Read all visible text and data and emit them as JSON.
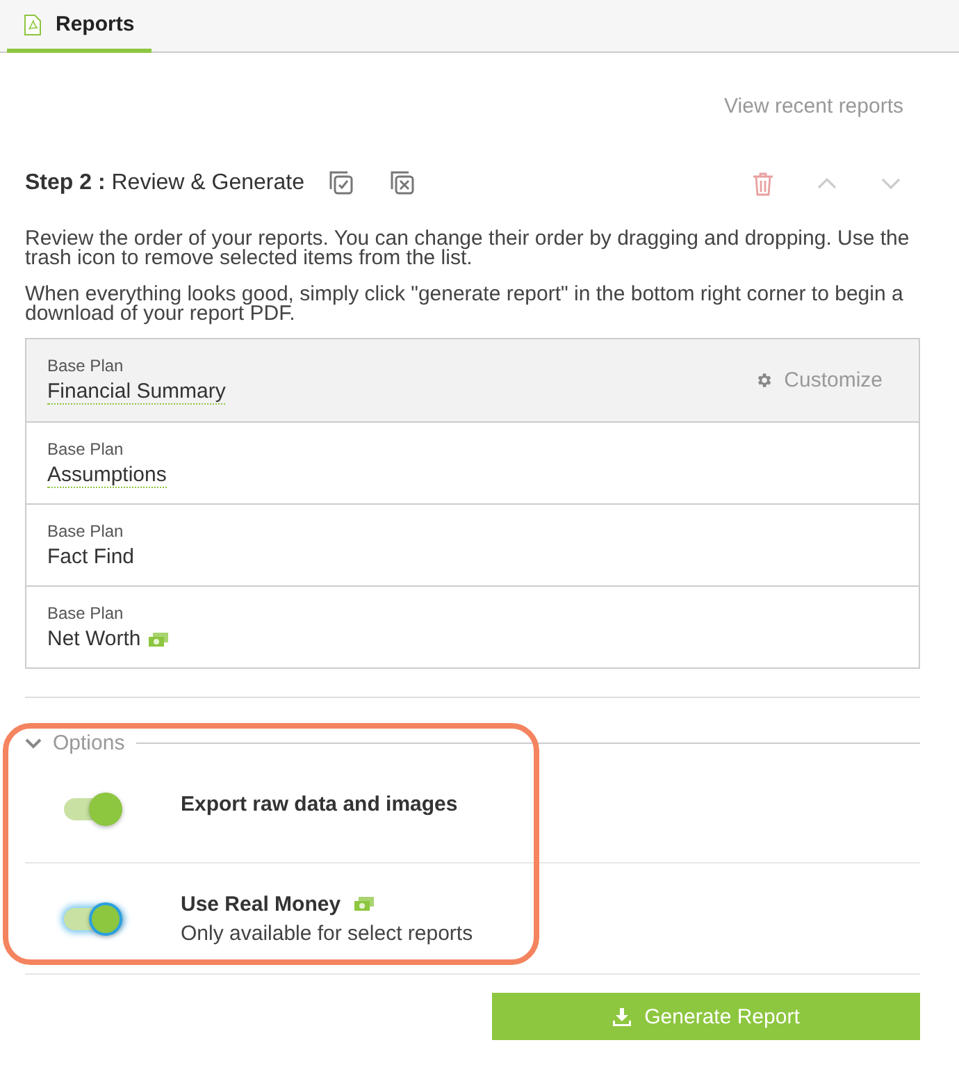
{
  "tabs": [
    {
      "label": "Reports",
      "selected": true
    }
  ],
  "recent_link": "View recent reports",
  "step": {
    "number": "Step 2 :",
    "title": "Review & Generate"
  },
  "description": [
    "Review the order of your reports. You can change their order by dragging and dropping. Use the trash icon to remove selected items from the list.",
    "When everything looks good, simply click \"generate report\" in the bottom right corner to begin a download of your report PDF."
  ],
  "reports": [
    {
      "plan": "Base Plan",
      "name": "Financial Summary",
      "selected": true,
      "underlined": true,
      "real_money": false,
      "action": "Customize"
    },
    {
      "plan": "Base Plan",
      "name": "Assumptions",
      "selected": false,
      "underlined": true,
      "real_money": false
    },
    {
      "plan": "Base Plan",
      "name": "Fact Find",
      "selected": false,
      "underlined": false,
      "real_money": false
    },
    {
      "plan": "Base Plan",
      "name": "Net Worth",
      "selected": false,
      "underlined": false,
      "real_money": true
    }
  ],
  "options": {
    "title": "Options",
    "expanded": true,
    "items": [
      {
        "label": "Export raw data and images",
        "on": true,
        "focused": false,
        "real_money": false
      },
      {
        "label": "Use Real Money",
        "note": "Only available for select reports",
        "on": true,
        "focused": true,
        "real_money": true
      }
    ]
  },
  "generate_button": "Generate Report"
}
